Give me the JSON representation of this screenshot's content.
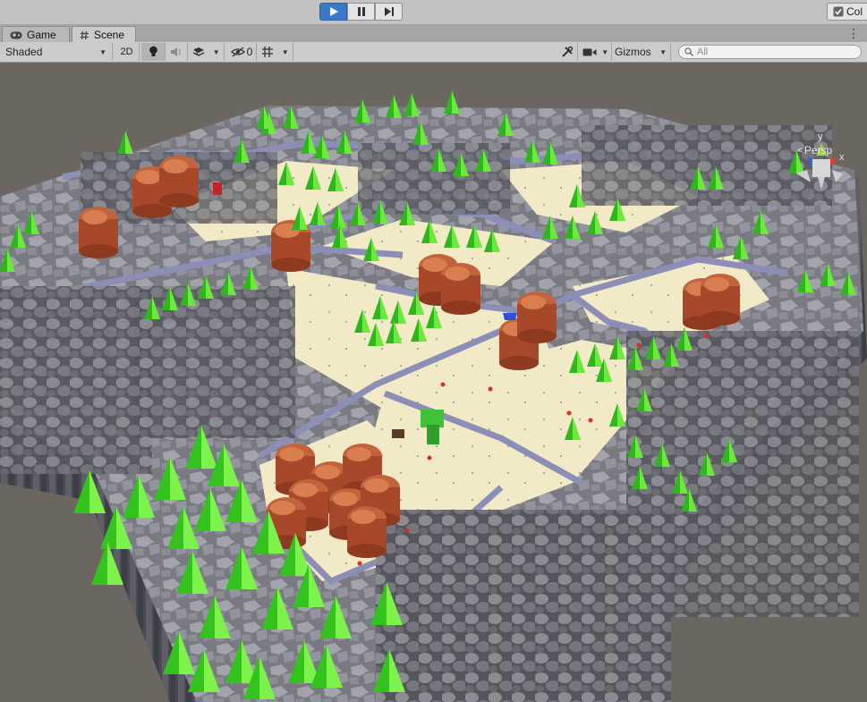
{
  "playbar": {
    "play_icon": "play-icon",
    "pause_icon": "pause-icon",
    "step_icon": "step-icon",
    "collab_label": "Col"
  },
  "tabs": [
    {
      "label": "Game",
      "icon": "gamepad-icon"
    },
    {
      "label": "Scene",
      "icon": "hash-icon"
    }
  ],
  "toolbar": {
    "draw_mode": "Shaded",
    "toggle_2d": "2D",
    "hidden_count": "0",
    "gizmos_label": "Gizmos",
    "search_placeholder": "All"
  },
  "scene_gizmo": {
    "axis_y": "y",
    "axis_x": "x",
    "projection": "Persp"
  },
  "colors": {
    "play_active": "#3a78c9",
    "toolbar_bg": "#cbcbcb",
    "viewport_bg": "#6b6660",
    "tree_green": "#4fd12b",
    "rock_gray": "#5c5c64",
    "rock_orange": "#b5552f",
    "floor_cream": "#f0e6c0"
  }
}
